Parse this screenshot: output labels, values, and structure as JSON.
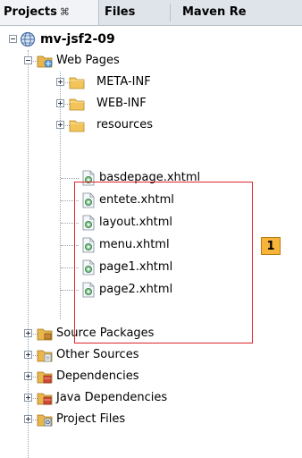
{
  "tabs": [
    {
      "label": "Projects",
      "close_glyph": "⌘",
      "active": true
    },
    {
      "label": "Files",
      "active": false
    },
    {
      "label": "Maven Re",
      "active": false
    }
  ],
  "tree": {
    "project": {
      "label": "mv-jsf2-09",
      "icon": "globe-project-icon"
    },
    "web_pages": {
      "label": "Web Pages",
      "icon": "web-pages-folder-icon"
    },
    "folders": [
      {
        "label": "META-INF",
        "icon": "folder-icon"
      },
      {
        "label": "WEB-INF",
        "icon": "folder-icon"
      },
      {
        "label": "resources",
        "icon": "folder-icon"
      }
    ],
    "files": [
      {
        "label": "basdepage.xhtml",
        "icon": "xhtml-file-icon"
      },
      {
        "label": "entete.xhtml",
        "icon": "xhtml-file-icon"
      },
      {
        "label": "layout.xhtml",
        "icon": "xhtml-file-icon"
      },
      {
        "label": "menu.xhtml",
        "icon": "xhtml-file-icon"
      },
      {
        "label": "page1.xhtml",
        "icon": "xhtml-file-icon"
      },
      {
        "label": "page2.xhtml",
        "icon": "xhtml-file-icon"
      }
    ],
    "other_nodes": [
      {
        "label": "Source Packages",
        "icon": "source-packages-icon"
      },
      {
        "label": "Other Sources",
        "icon": "other-sources-icon"
      },
      {
        "label": "Dependencies",
        "icon": "dependencies-icon"
      },
      {
        "label": "Java Dependencies",
        "icon": "java-dependencies-icon"
      },
      {
        "label": "Project Files",
        "icon": "project-files-icon"
      }
    ]
  },
  "annotation": {
    "label": "1",
    "color": "#f7b43a",
    "box_color": "#e0252b"
  }
}
